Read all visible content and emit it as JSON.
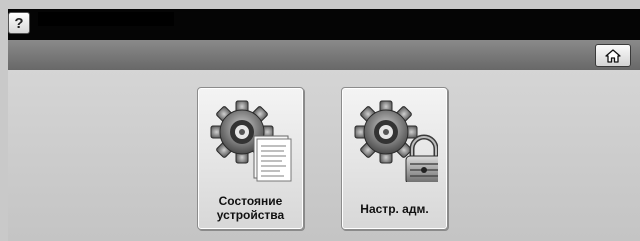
{
  "header": {
    "help_label": "?",
    "title": ""
  },
  "toolbar": {
    "home_icon": "home-icon"
  },
  "tiles": [
    {
      "label_line1": "Состояние",
      "label_line2": "устройства",
      "icon": "gear-document-icon"
    },
    {
      "label": "Настр. адм.",
      "icon": "gear-padlock-icon"
    }
  ]
}
